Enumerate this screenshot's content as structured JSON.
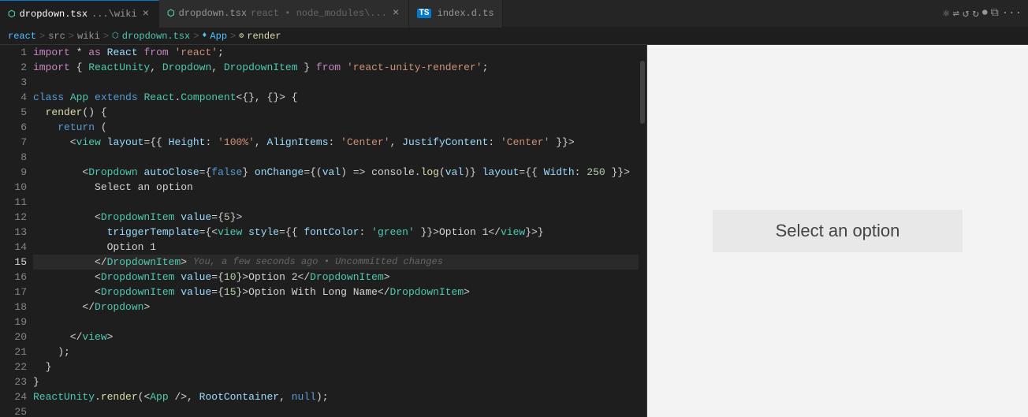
{
  "tabs": [
    {
      "id": "tab1",
      "label": "dropdown.tsx",
      "sublabel": "...\\wiki",
      "icon": "tsx-icon",
      "active": true,
      "modified": false,
      "showClose": true
    },
    {
      "id": "tab2",
      "label": "dropdown.tsx",
      "sublabel": "react • node_modules\\...",
      "icon": "tsx-icon",
      "active": false,
      "modified": false,
      "showClose": true
    },
    {
      "id": "tab3",
      "label": "index.d.ts",
      "sublabel": "",
      "icon": "ts-icon",
      "active": false,
      "modified": false,
      "showClose": false
    }
  ],
  "breadcrumb": {
    "items": [
      "react",
      ">",
      "src",
      ">",
      "wiki",
      ">",
      "dropdown.tsx",
      ">",
      "App",
      ">",
      "render"
    ]
  },
  "toolbar_icons": [
    "run-icon",
    "broadcast-icon",
    "back-icon",
    "forward-icon",
    "record-icon",
    "split-icon",
    "more-icon"
  ],
  "lines": [
    {
      "num": 1,
      "content": [
        {
          "type": "kw2",
          "text": "import"
        },
        {
          "type": "plain",
          "text": " * "
        },
        {
          "type": "kw2",
          "text": "as"
        },
        {
          "type": "plain",
          "text": " "
        },
        {
          "type": "var",
          "text": "React"
        },
        {
          "type": "plain",
          "text": " "
        },
        {
          "type": "kw2",
          "text": "from"
        },
        {
          "type": "plain",
          "text": " "
        },
        {
          "type": "str",
          "text": "'react'"
        }
      ],
      "highlight": false
    },
    {
      "num": 2,
      "content": [
        {
          "type": "kw2",
          "text": "import"
        },
        {
          "type": "plain",
          "text": " { "
        },
        {
          "type": "cls",
          "text": "ReactUnity"
        },
        {
          "type": "plain",
          "text": ", "
        },
        {
          "type": "cls",
          "text": "Dropdown"
        },
        {
          "type": "plain",
          "text": ", "
        },
        {
          "type": "cls",
          "text": "DropdownItem"
        },
        {
          "type": "plain",
          "text": " } "
        },
        {
          "type": "kw2",
          "text": "from"
        },
        {
          "type": "plain",
          "text": " "
        },
        {
          "type": "str",
          "text": "'react-unity-renderer'"
        }
      ],
      "highlight": false
    },
    {
      "num": 3,
      "content": [],
      "highlight": false
    },
    {
      "num": 4,
      "content": [
        {
          "type": "kw",
          "text": "class"
        },
        {
          "type": "plain",
          "text": " "
        },
        {
          "type": "cls",
          "text": "App"
        },
        {
          "type": "plain",
          "text": " "
        },
        {
          "type": "kw",
          "text": "extends"
        },
        {
          "type": "plain",
          "text": " "
        },
        {
          "type": "cls",
          "text": "React"
        },
        {
          "type": "plain",
          "text": "."
        },
        {
          "type": "cls",
          "text": "Component"
        },
        {
          "type": "plain",
          "text": "<{}, {}> {"
        }
      ],
      "highlight": false
    },
    {
      "num": 5,
      "content": [
        {
          "type": "plain",
          "text": "  "
        },
        {
          "type": "fn",
          "text": "render"
        },
        {
          "type": "plain",
          "text": "() {"
        }
      ],
      "highlight": false
    },
    {
      "num": 6,
      "content": [
        {
          "type": "plain",
          "text": "    "
        },
        {
          "type": "kw",
          "text": "return"
        },
        {
          "type": "plain",
          "text": " ("
        }
      ],
      "highlight": false
    },
    {
      "num": 7,
      "content": [
        {
          "type": "plain",
          "text": "      <"
        },
        {
          "type": "jsx-tag",
          "text": "view"
        },
        {
          "type": "plain",
          "text": " "
        },
        {
          "type": "jsx-attr",
          "text": "layout"
        },
        {
          "type": "plain",
          "text": "={{"
        },
        {
          "type": "plain",
          "text": " "
        },
        {
          "type": "prop",
          "text": "Height"
        },
        {
          "type": "plain",
          "text": ": "
        },
        {
          "type": "str",
          "text": "'100%'"
        },
        {
          "type": "plain",
          "text": ", "
        },
        {
          "type": "prop",
          "text": "AlignItems"
        },
        {
          "type": "plain",
          "text": ": "
        },
        {
          "type": "str",
          "text": "'Center'"
        },
        {
          "type": "plain",
          "text": ", "
        },
        {
          "type": "prop",
          "text": "JustifyContent"
        },
        {
          "type": "plain",
          "text": ": "
        },
        {
          "type": "str",
          "text": "'Center'"
        },
        {
          "type": "plain",
          "text": " }}>"
        }
      ],
      "highlight": false
    },
    {
      "num": 8,
      "content": [],
      "highlight": false
    },
    {
      "num": 9,
      "content": [
        {
          "type": "plain",
          "text": "        <"
        },
        {
          "type": "cls",
          "text": "Dropdown"
        },
        {
          "type": "plain",
          "text": " "
        },
        {
          "type": "jsx-attr",
          "text": "autoClose"
        },
        {
          "type": "plain",
          "text": "={"
        },
        {
          "type": "kw",
          "text": "false"
        },
        {
          "type": "plain",
          "text": "} "
        },
        {
          "type": "jsx-attr",
          "text": "onChange"
        },
        {
          "type": "plain",
          "text": "={("
        },
        {
          "type": "var",
          "text": "val"
        },
        {
          "type": "plain",
          "text": ") => "
        },
        {
          "type": "plain",
          "text": "console."
        },
        {
          "type": "fn",
          "text": "log"
        },
        {
          "type": "plain",
          "text": "("
        },
        {
          "type": "var",
          "text": "val"
        },
        {
          "type": "plain",
          "text": ")} "
        },
        {
          "type": "jsx-attr",
          "text": "layout"
        },
        {
          "type": "plain",
          "text": "={{ "
        },
        {
          "type": "prop",
          "text": "Width"
        },
        {
          "type": "plain",
          "text": ": "
        },
        {
          "type": "num",
          "text": "250"
        },
        {
          "type": "plain",
          "text": " }}>"
        }
      ],
      "highlight": false
    },
    {
      "num": 10,
      "content": [
        {
          "type": "plain",
          "text": "          "
        },
        {
          "type": "plain",
          "text": "Select an option"
        }
      ],
      "highlight": false
    },
    {
      "num": 11,
      "content": [],
      "highlight": false
    },
    {
      "num": 12,
      "content": [
        {
          "type": "plain",
          "text": "          <"
        },
        {
          "type": "cls",
          "text": "DropdownItem"
        },
        {
          "type": "plain",
          "text": " "
        },
        {
          "type": "jsx-attr",
          "text": "value"
        },
        {
          "type": "plain",
          "text": "={"
        },
        {
          "type": "num",
          "text": "5"
        },
        {
          "type": "plain",
          "text": "}>"
        }
      ],
      "highlight": false
    },
    {
      "num": 13,
      "content": [
        {
          "type": "plain",
          "text": "            "
        },
        {
          "type": "jsx-attr",
          "text": "triggerTemplate"
        },
        {
          "type": "plain",
          "text": "={<"
        },
        {
          "type": "jsx-tag",
          "text": "view"
        },
        {
          "type": "plain",
          "text": " "
        },
        {
          "type": "jsx-attr",
          "text": "style"
        },
        {
          "type": "plain",
          "text": "={{ "
        },
        {
          "type": "prop",
          "text": "fontColor"
        },
        {
          "type": "plain",
          "text": ": "
        },
        {
          "type": "str2",
          "text": "'green'"
        },
        {
          "type": "plain",
          "text": " }}>Option 1</"
        },
        {
          "type": "jsx-tag",
          "text": "view"
        },
        {
          "type": "plain",
          "text": "}>"
        }
      ],
      "highlight": false
    },
    {
      "num": 14,
      "content": [
        {
          "type": "plain",
          "text": "            Option 1"
        }
      ],
      "highlight": false
    },
    {
      "num": 15,
      "content": [
        {
          "type": "plain",
          "text": "          </"
        },
        {
          "type": "cls",
          "text": "DropdownItem"
        },
        {
          "type": "plain",
          "text": ">"
        }
      ],
      "highlight": true,
      "blame": "You, a few seconds ago • Uncommitted changes"
    },
    {
      "num": 16,
      "content": [
        {
          "type": "plain",
          "text": "          <"
        },
        {
          "type": "cls",
          "text": "DropdownItem"
        },
        {
          "type": "plain",
          "text": " "
        },
        {
          "type": "jsx-attr",
          "text": "value"
        },
        {
          "type": "plain",
          "text": "={"
        },
        {
          "type": "num",
          "text": "10"
        },
        {
          "type": "plain",
          "text": "}>Option 2</"
        },
        {
          "type": "cls",
          "text": "DropdownItem"
        },
        {
          "type": "plain",
          "text": ">"
        }
      ],
      "highlight": false
    },
    {
      "num": 17,
      "content": [
        {
          "type": "plain",
          "text": "          <"
        },
        {
          "type": "cls",
          "text": "DropdownItem"
        },
        {
          "type": "plain",
          "text": " "
        },
        {
          "type": "jsx-attr",
          "text": "value"
        },
        {
          "type": "plain",
          "text": "={"
        },
        {
          "type": "num",
          "text": "15"
        },
        {
          "type": "plain",
          "text": "}>Option With Long Name</"
        },
        {
          "type": "cls",
          "text": "DropdownItem"
        },
        {
          "type": "plain",
          "text": ">"
        }
      ],
      "highlight": false
    },
    {
      "num": 18,
      "content": [
        {
          "type": "plain",
          "text": "        </"
        },
        {
          "type": "cls",
          "text": "Dropdown"
        },
        {
          "type": "plain",
          "text": ">"
        }
      ],
      "highlight": false
    },
    {
      "num": 19,
      "content": [],
      "highlight": false
    },
    {
      "num": 20,
      "content": [
        {
          "type": "plain",
          "text": "      </"
        },
        {
          "type": "jsx-tag",
          "text": "view"
        },
        {
          "type": "plain",
          "text": ">"
        }
      ],
      "highlight": false
    },
    {
      "num": 21,
      "content": [
        {
          "type": "plain",
          "text": "    );"
        }
      ],
      "highlight": false
    },
    {
      "num": 22,
      "content": [
        {
          "type": "plain",
          "text": "  }"
        }
      ],
      "highlight": false
    },
    {
      "num": 23,
      "content": [
        {
          "type": "plain",
          "text": "}"
        }
      ],
      "highlight": false
    },
    {
      "num": 24,
      "content": [
        {
          "type": "cls",
          "text": "ReactUnity"
        },
        {
          "type": "plain",
          "text": "."
        },
        {
          "type": "fn",
          "text": "render"
        },
        {
          "type": "plain",
          "text": "(<"
        },
        {
          "type": "cls",
          "text": "App"
        },
        {
          "type": "plain",
          "text": " />, "
        },
        {
          "type": "var",
          "text": "RootContainer"
        },
        {
          "type": "plain",
          "text": ", "
        },
        {
          "type": "kw",
          "text": "null"
        },
        {
          "type": "plain",
          "text": ");"
        }
      ],
      "highlight": false
    },
    {
      "num": 25,
      "content": [],
      "highlight": false
    }
  ],
  "preview": {
    "text": "Select an option"
  },
  "colors": {
    "accent": "#007acc",
    "bg_dark": "#1e1e1e",
    "bg_tab_inactive": "#2d2d2d",
    "bg_sidebar": "#252526",
    "preview_bg": "#f3f3f3",
    "preview_dropdown_bg": "#e8e8e8"
  }
}
